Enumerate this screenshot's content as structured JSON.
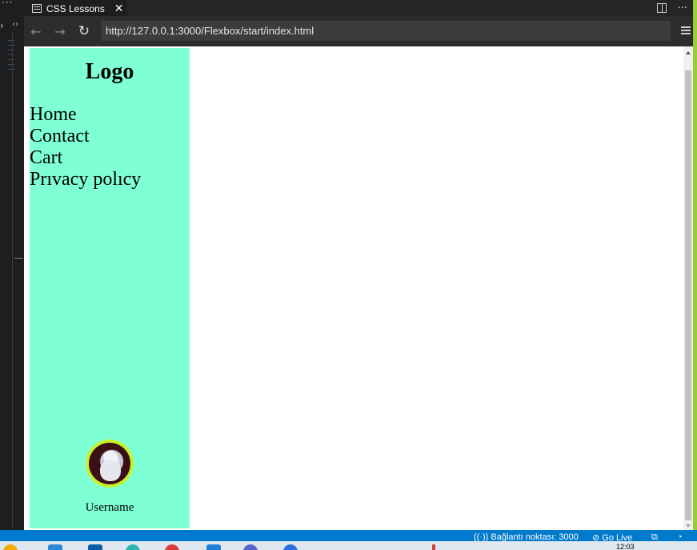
{
  "tab": {
    "title": "CSS Lessons",
    "close": "✕"
  },
  "tab_actions": {
    "more": "···"
  },
  "editor": {
    "more": "···",
    "chevron": "›",
    "brackets": "‹›"
  },
  "nav": {
    "back": "←",
    "forward": "→",
    "reload": "↻",
    "url": "http://127.0.0.1:3000/Flexbox/start/index.html"
  },
  "page": {
    "logo": "Logo",
    "menu": [
      "Home",
      "Contact",
      "Cart",
      "Prıvacy polıcy"
    ],
    "username": "Username",
    "colors": {
      "sidebar": "#7fffd4",
      "avatar_ring": "#c6f12c"
    }
  },
  "statusbar": {
    "port": "((·)) Bağlantı noktası: 3000",
    "golive": "⊘ Go Live"
  },
  "taskbar": {
    "clock": "12:03"
  }
}
